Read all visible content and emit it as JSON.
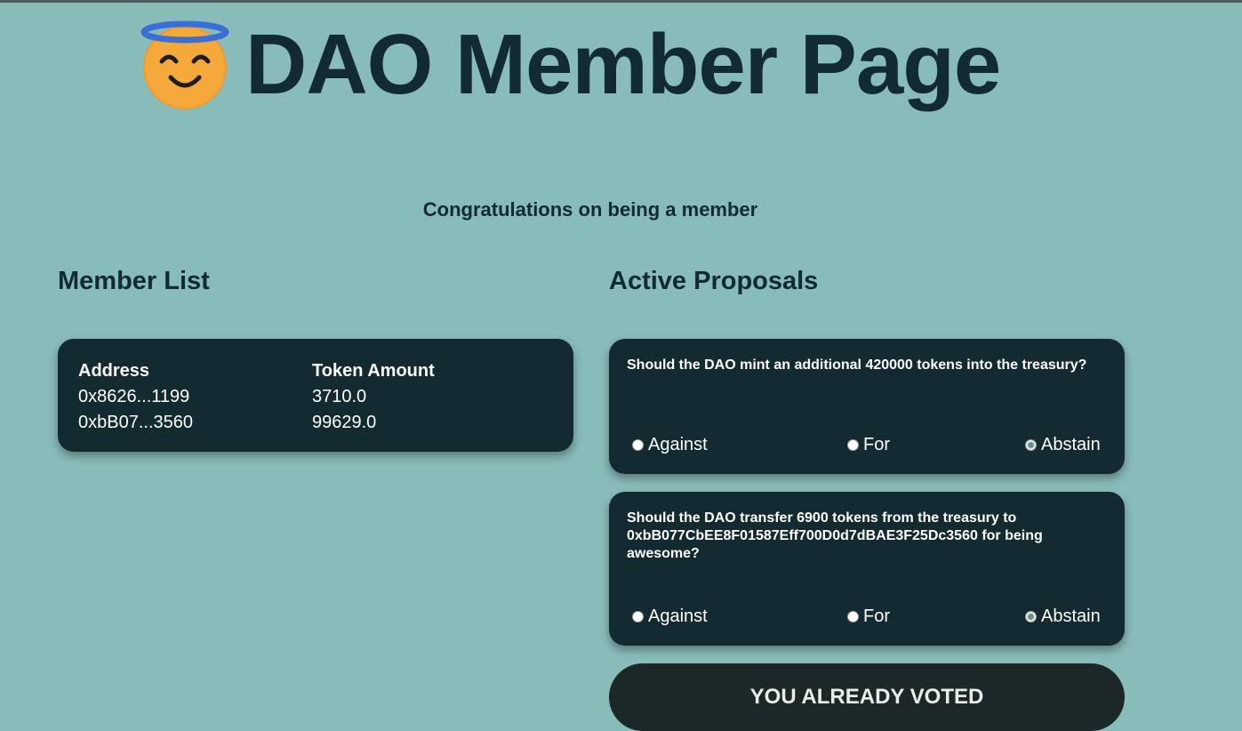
{
  "header": {
    "title": "DAO Member Page",
    "icon": "smiling-face-with-halo-icon"
  },
  "congrats": "Congratulations on being a member",
  "member_list": {
    "title": "Member List",
    "columns": [
      "Address",
      "Token Amount"
    ],
    "rows": [
      {
        "address": "0x8626...1199",
        "amount": "3710.0"
      },
      {
        "address": "0xbB07...3560",
        "amount": "99629.0"
      }
    ]
  },
  "proposals": {
    "title": "Active Proposals",
    "items": [
      {
        "question": "Should the DAO mint an additional 420000 tokens into the treasury?",
        "options": [
          "Against",
          "For",
          "Abstain"
        ],
        "selected": "Abstain"
      },
      {
        "question": "Should the DAO transfer 6900 tokens from the treasury to 0xbB077CbEE8F01587Eff700D0d7dBAE3F25Dc3560 for being awesome?",
        "options": [
          "Against",
          "For",
          "Abstain"
        ],
        "selected": "Abstain"
      }
    ]
  },
  "vote_button": {
    "label": "YOU ALREADY VOTED"
  },
  "colors": {
    "background": "#88bcb9",
    "card": "#132a31",
    "button": "#1c2728",
    "text_dark": "#122a31",
    "emoji_face": "#f6a93b",
    "halo": "#3b6fd8"
  }
}
